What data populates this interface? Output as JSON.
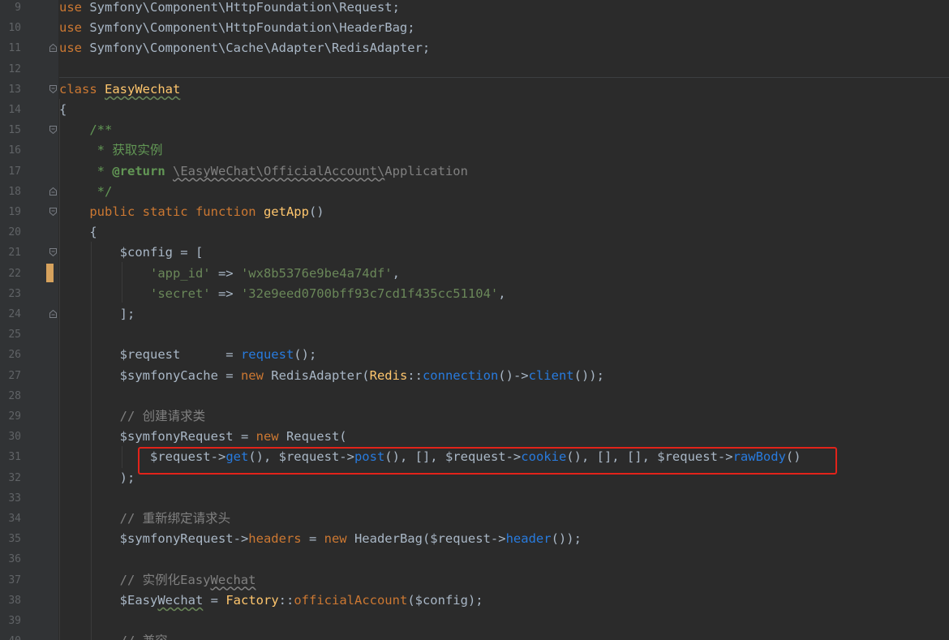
{
  "editor": {
    "lines": [
      {
        "n": "9",
        "segments": [
          [
            "kw",
            "use "
          ],
          [
            "cls",
            "Symfony\\Component\\HttpFoundation\\Request;"
          ]
        ]
      },
      {
        "n": "10",
        "segments": [
          [
            "kw",
            "use "
          ],
          [
            "cls",
            "Symfony\\Component\\HttpFoundation\\HeaderBag;"
          ]
        ]
      },
      {
        "n": "11",
        "segments": [
          [
            "kw",
            "use "
          ],
          [
            "cls",
            "Symfony\\Component\\Cache\\Adapter\\RedisAdapter;"
          ]
        ]
      },
      {
        "n": "12",
        "segments": []
      },
      {
        "n": "13",
        "segments": [
          [
            "kw",
            "class "
          ],
          [
            "clsname-wavy",
            "EasyWechat"
          ]
        ]
      },
      {
        "n": "14",
        "segments": [
          [
            "cls",
            "{"
          ]
        ]
      },
      {
        "n": "15",
        "segments": [
          [
            "cls",
            "    "
          ],
          [
            "cmt",
            "/**"
          ]
        ]
      },
      {
        "n": "16",
        "segments": [
          [
            "cls",
            "     "
          ],
          [
            "cmt",
            "* 获取实例"
          ]
        ]
      },
      {
        "n": "17",
        "segments": [
          [
            "cls",
            "     "
          ],
          [
            "cmt",
            "* "
          ],
          [
            "doctag",
            "@return "
          ],
          [
            "cmt-wavy",
            "\\EasyWeChat\\OfficialAccount\\"
          ],
          [
            "cmt-gray",
            "Application"
          ]
        ]
      },
      {
        "n": "18",
        "segments": [
          [
            "cls",
            "     "
          ],
          [
            "cmt",
            "*/"
          ]
        ]
      },
      {
        "n": "19",
        "segments": [
          [
            "cls",
            "    "
          ],
          [
            "kw",
            "public static function "
          ],
          [
            "fn",
            "getApp"
          ],
          [
            "cls",
            "()"
          ]
        ]
      },
      {
        "n": "20",
        "segments": [
          [
            "cls",
            "    {"
          ]
        ]
      },
      {
        "n": "21",
        "segments": [
          [
            "cls",
            "        $config = ["
          ]
        ]
      },
      {
        "n": "22",
        "segments": [
          [
            "cls",
            "            "
          ],
          [
            "str",
            "'app_id'"
          ],
          [
            "cls",
            " => "
          ],
          [
            "str",
            "'wx8b5376e9be4a74df'"
          ],
          [
            "cls",
            ","
          ]
        ]
      },
      {
        "n": "23",
        "segments": [
          [
            "cls",
            "            "
          ],
          [
            "str",
            "'secret'"
          ],
          [
            "cls",
            " => "
          ],
          [
            "str",
            "'32e9eed0700bff93c7cd1f435cc51104'"
          ],
          [
            "cls",
            ","
          ]
        ]
      },
      {
        "n": "24",
        "segments": [
          [
            "cls",
            "        ];"
          ]
        ]
      },
      {
        "n": "25",
        "segments": []
      },
      {
        "n": "26",
        "segments": [
          [
            "cls",
            "        $request      = "
          ],
          [
            "call",
            "request"
          ],
          [
            "cls",
            "();"
          ]
        ]
      },
      {
        "n": "27",
        "segments": [
          [
            "cls",
            "        $symfonyCache = "
          ],
          [
            "kw",
            "new "
          ],
          [
            "cls",
            "RedisAdapter("
          ],
          [
            "clsname",
            "Redis"
          ],
          [
            "cls",
            "::"
          ],
          [
            "call",
            "connection"
          ],
          [
            "cls",
            "()->"
          ],
          [
            "call",
            "client"
          ],
          [
            "cls",
            "());"
          ]
        ]
      },
      {
        "n": "28",
        "segments": []
      },
      {
        "n": "29",
        "segments": [
          [
            "cls",
            "        "
          ],
          [
            "cmt-gray",
            "// 创建请求类"
          ]
        ]
      },
      {
        "n": "30",
        "segments": [
          [
            "cls",
            "        $symfonyRequest = "
          ],
          [
            "kw",
            "new "
          ],
          [
            "cls",
            "Request("
          ]
        ]
      },
      {
        "n": "31",
        "segments": [
          [
            "cls",
            "            $request->"
          ],
          [
            "call",
            "get"
          ],
          [
            "cls",
            "(), $request->"
          ],
          [
            "call",
            "post"
          ],
          [
            "cls",
            "(), [], $request->"
          ],
          [
            "call",
            "cookie"
          ],
          [
            "cls",
            "(), [], [], $request->"
          ],
          [
            "call",
            "rawBody"
          ],
          [
            "cls",
            "()"
          ]
        ]
      },
      {
        "n": "32",
        "segments": [
          [
            "cls",
            "        );"
          ]
        ]
      },
      {
        "n": "33",
        "segments": []
      },
      {
        "n": "34",
        "segments": [
          [
            "cls",
            "        "
          ],
          [
            "cmt-gray",
            "// 重新绑定请求头"
          ]
        ]
      },
      {
        "n": "35",
        "segments": [
          [
            "cls",
            "        $symfonyRequest->"
          ],
          [
            "prop",
            "headers"
          ],
          [
            "cls",
            " = "
          ],
          [
            "kw",
            "new "
          ],
          [
            "cls",
            "HeaderBag($request->"
          ],
          [
            "call",
            "header"
          ],
          [
            "cls",
            "());"
          ]
        ]
      },
      {
        "n": "36",
        "segments": []
      },
      {
        "n": "37",
        "segments": [
          [
            "cls",
            "        "
          ],
          [
            "cmt-gray",
            "// 实例化Easy"
          ],
          [
            "cmt-gray-wavy",
            "Wechat"
          ]
        ]
      },
      {
        "n": "38",
        "segments": [
          [
            "cls",
            "        $Easy"
          ],
          [
            "cls-wavy",
            "Wechat"
          ],
          [
            "cls",
            " = "
          ],
          [
            "clsname",
            "Factory"
          ],
          [
            "cls",
            "::"
          ],
          [
            "static",
            "officialAccount"
          ],
          [
            "cls",
            "($config);"
          ]
        ]
      },
      {
        "n": "39",
        "segments": []
      },
      {
        "n": "40",
        "segments": [
          [
            "cls",
            "        "
          ],
          [
            "cmt-gray",
            "// 兼容..."
          ]
        ]
      }
    ]
  },
  "colors": {
    "background": "#2b2b2b",
    "keyword": "#cc7832",
    "string": "#6a8759",
    "method": "#287bde",
    "highlight_box": "#e2231a"
  }
}
